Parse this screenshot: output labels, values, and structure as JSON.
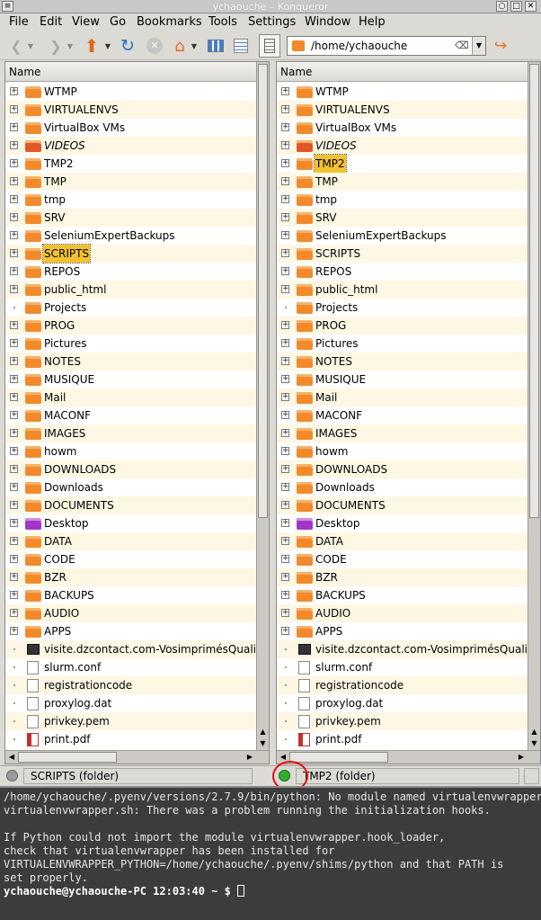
{
  "window": {
    "title": "ychaouche – Konqueror"
  },
  "menu": [
    "File",
    "Edit",
    "View",
    "Go",
    "Bookmarks",
    "Tools",
    "Settings",
    "Window",
    "Help"
  ],
  "location": {
    "value": "/home/ychaouche"
  },
  "panes": [
    {
      "header": "Name",
      "selected": "SCRIPTS",
      "items": [
        {
          "name": "WTMP",
          "type": "folder",
          "expandable": true
        },
        {
          "name": "VIRTUALENVS",
          "type": "folder",
          "expandable": true
        },
        {
          "name": "VirtualBox VMs",
          "type": "folder",
          "expandable": true
        },
        {
          "name": "VIDEOS",
          "type": "folder-video",
          "expandable": true
        },
        {
          "name": "TMP2",
          "type": "folder",
          "expandable": true
        },
        {
          "name": "TMP",
          "type": "folder",
          "expandable": true
        },
        {
          "name": "tmp",
          "type": "folder",
          "expandable": true
        },
        {
          "name": "SRV",
          "type": "folder",
          "expandable": true
        },
        {
          "name": "SeleniumExpertBackups",
          "type": "folder",
          "expandable": true
        },
        {
          "name": "SCRIPTS",
          "type": "folder",
          "expandable": true
        },
        {
          "name": "REPOS",
          "type": "folder",
          "expandable": true
        },
        {
          "name": "public_html",
          "type": "folder",
          "expandable": true
        },
        {
          "name": "Projects",
          "type": "folder",
          "expandable": false
        },
        {
          "name": "PROG",
          "type": "folder",
          "expandable": true
        },
        {
          "name": "Pictures",
          "type": "folder",
          "expandable": true
        },
        {
          "name": "NOTES",
          "type": "folder",
          "expandable": true
        },
        {
          "name": "MUSIQUE",
          "type": "folder",
          "expandable": true
        },
        {
          "name": "Mail",
          "type": "folder",
          "expandable": true
        },
        {
          "name": "MACONF",
          "type": "folder",
          "expandable": true
        },
        {
          "name": "IMAGES",
          "type": "folder",
          "expandable": true
        },
        {
          "name": "howm",
          "type": "folder",
          "expandable": true
        },
        {
          "name": "DOWNLOADS",
          "type": "folder",
          "expandable": true
        },
        {
          "name": "Downloads",
          "type": "folder",
          "expandable": true
        },
        {
          "name": "DOCUMENTS",
          "type": "folder",
          "expandable": true
        },
        {
          "name": "Desktop",
          "type": "folder-desktop",
          "expandable": true
        },
        {
          "name": "DATA",
          "type": "folder",
          "expandable": true
        },
        {
          "name": "CODE",
          "type": "folder",
          "expandable": true
        },
        {
          "name": "BZR",
          "type": "folder",
          "expandable": true
        },
        {
          "name": "BACKUPS",
          "type": "folder",
          "expandable": true
        },
        {
          "name": "AUDIO",
          "type": "folder",
          "expandable": true
        },
        {
          "name": "APPS",
          "type": "folder",
          "expandable": true
        },
        {
          "name": "visite.dzcontact.com-VosimprimésQuali",
          "type": "terminal",
          "expandable": false
        },
        {
          "name": "slurm.conf",
          "type": "file",
          "expandable": false
        },
        {
          "name": "registrationcode",
          "type": "file",
          "expandable": false
        },
        {
          "name": "proxylog.dat",
          "type": "file",
          "expandable": false
        },
        {
          "name": "privkey.pem",
          "type": "file",
          "expandable": false
        },
        {
          "name": "print.pdf",
          "type": "pdf",
          "expandable": false
        }
      ]
    },
    {
      "header": "Name",
      "selected": "TMP2",
      "items": [
        {
          "name": "WTMP",
          "type": "folder",
          "expandable": true
        },
        {
          "name": "VIRTUALENVS",
          "type": "folder",
          "expandable": true
        },
        {
          "name": "VirtualBox VMs",
          "type": "folder",
          "expandable": true
        },
        {
          "name": "VIDEOS",
          "type": "folder-video",
          "expandable": true
        },
        {
          "name": "TMP2",
          "type": "folder",
          "expandable": true
        },
        {
          "name": "TMP",
          "type": "folder",
          "expandable": true
        },
        {
          "name": "tmp",
          "type": "folder",
          "expandable": true
        },
        {
          "name": "SRV",
          "type": "folder",
          "expandable": true
        },
        {
          "name": "SeleniumExpertBackups",
          "type": "folder",
          "expandable": true
        },
        {
          "name": "SCRIPTS",
          "type": "folder",
          "expandable": true
        },
        {
          "name": "REPOS",
          "type": "folder",
          "expandable": true
        },
        {
          "name": "public_html",
          "type": "folder",
          "expandable": true
        },
        {
          "name": "Projects",
          "type": "folder",
          "expandable": false
        },
        {
          "name": "PROG",
          "type": "folder",
          "expandable": true
        },
        {
          "name": "Pictures",
          "type": "folder",
          "expandable": true
        },
        {
          "name": "NOTES",
          "type": "folder",
          "expandable": true
        },
        {
          "name": "MUSIQUE",
          "type": "folder",
          "expandable": true
        },
        {
          "name": "Mail",
          "type": "folder",
          "expandable": true
        },
        {
          "name": "MACONF",
          "type": "folder",
          "expandable": true
        },
        {
          "name": "IMAGES",
          "type": "folder",
          "expandable": true
        },
        {
          "name": "howm",
          "type": "folder",
          "expandable": true
        },
        {
          "name": "DOWNLOADS",
          "type": "folder",
          "expandable": true
        },
        {
          "name": "Downloads",
          "type": "folder",
          "expandable": true
        },
        {
          "name": "DOCUMENTS",
          "type": "folder",
          "expandable": true
        },
        {
          "name": "Desktop",
          "type": "folder-desktop",
          "expandable": true
        },
        {
          "name": "DATA",
          "type": "folder",
          "expandable": true
        },
        {
          "name": "CODE",
          "type": "folder",
          "expandable": true
        },
        {
          "name": "BZR",
          "type": "folder",
          "expandable": true
        },
        {
          "name": "BACKUPS",
          "type": "folder",
          "expandable": true
        },
        {
          "name": "AUDIO",
          "type": "folder",
          "expandable": true
        },
        {
          "name": "APPS",
          "type": "folder",
          "expandable": true
        },
        {
          "name": "visite.dzcontact.com-VosimprimésQuali",
          "type": "terminal",
          "expandable": false
        },
        {
          "name": "slurm.conf",
          "type": "file",
          "expandable": false
        },
        {
          "name": "registrationcode",
          "type": "file",
          "expandable": false
        },
        {
          "name": "proxylog.dat",
          "type": "file",
          "expandable": false
        },
        {
          "name": "privkey.pem",
          "type": "file",
          "expandable": false
        },
        {
          "name": "print.pdf",
          "type": "pdf",
          "expandable": false
        }
      ]
    }
  ],
  "status": {
    "left": "SCRIPTS (folder)",
    "right": "TMP2 (folder)",
    "active_indicator_color": "#2fae2f"
  },
  "terminal": {
    "lines": [
      "/home/ychaouche/.pyenv/versions/2.7.9/bin/python: No module named virtualenvwrapper",
      "virtualenvwrapper.sh: There was a problem running the initialization hooks.",
      "",
      "If Python could not import the module virtualenvwrapper.hook_loader,",
      "check that virtualenvwrapper has been installed for",
      "VIRTUALENVWRAPPER_PYTHON=/home/ychaouche/.pyenv/shims/python and that PATH is",
      "set properly."
    ],
    "prompt": "ychaouche@ychaouche-PC 12:03:40 ~ $"
  },
  "icons": {
    "back": "back-arrow-icon",
    "forward": "forward-arrow-icon",
    "up": "up-arrow-icon",
    "reload": "reload-icon",
    "stop": "stop-icon",
    "home": "home-icon"
  },
  "colors": {
    "folder": "#f28a2c",
    "selection": "#f2c22e",
    "annotation": "#e21010"
  }
}
